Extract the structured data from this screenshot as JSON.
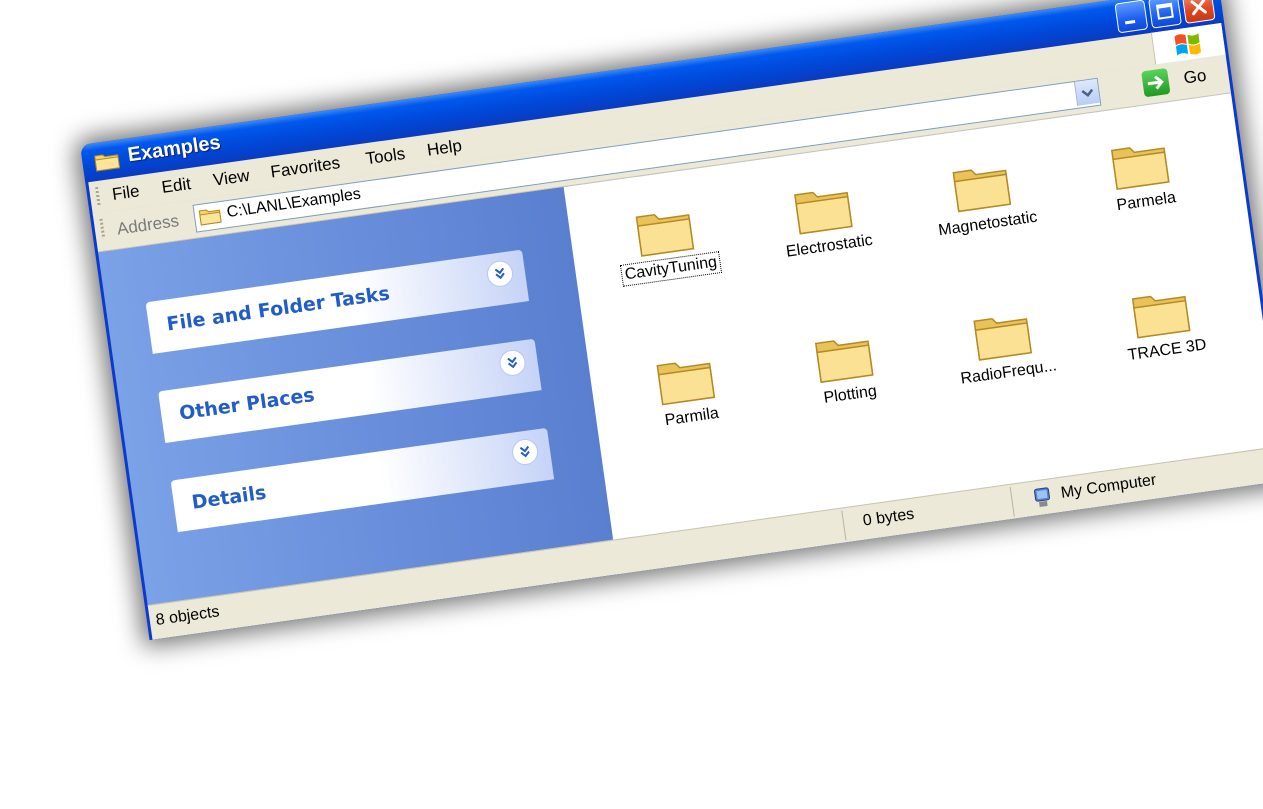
{
  "window": {
    "title": "Examples",
    "title_icon": "folder-icon",
    "buttons": [
      "minimize-icon",
      "maximize-icon",
      "close-icon"
    ]
  },
  "menu": {
    "items": [
      "File",
      "Edit",
      "View",
      "Favorites",
      "Tools",
      "Help"
    ]
  },
  "address": {
    "label": "Address",
    "value": "C:\\LANL\\Examples",
    "go_label": "Go"
  },
  "tasks": [
    {
      "label": "File and Folder Tasks"
    },
    {
      "label": "Other Places"
    },
    {
      "label": "Details"
    }
  ],
  "files": [
    {
      "name": "CavityTuning",
      "focused": true
    },
    {
      "name": "Electrostatic"
    },
    {
      "name": "Magnetostatic"
    },
    {
      "name": "Parmela"
    },
    {
      "name": "Parmila"
    },
    {
      "name": "Plotting"
    },
    {
      "name": "RadioFrequ..."
    },
    {
      "name": "TRACE 3D"
    }
  ],
  "status": {
    "count": "8 objects",
    "size": "0 bytes",
    "zone": "My Computer"
  },
  "colors": {
    "titlebar": "#0058ee",
    "task_pane": "#6a8fdc",
    "task_header_text": "#215dc6",
    "chrome": "#ece9d8"
  }
}
